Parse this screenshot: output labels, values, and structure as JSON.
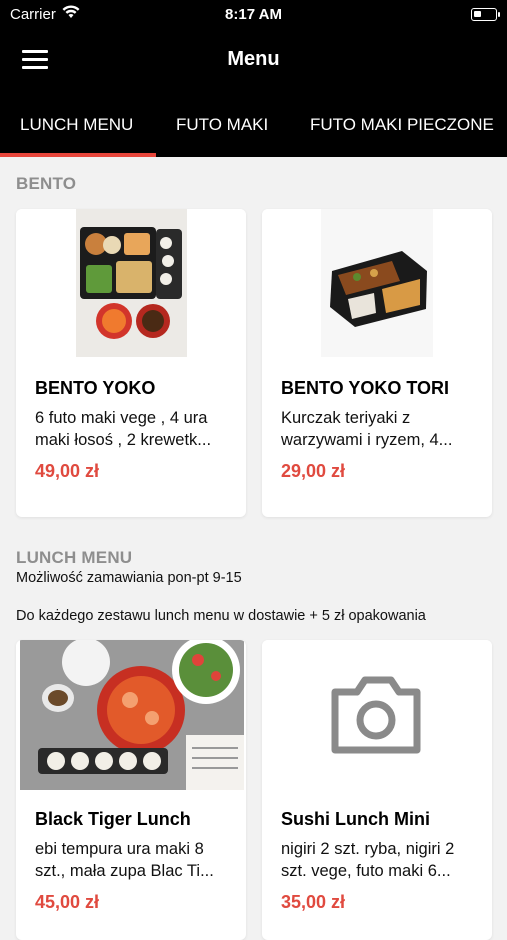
{
  "status": {
    "carrier": "Carrier",
    "time": "8:17 AM",
    "battery_level": 0.35
  },
  "nav": {
    "title": "Menu"
  },
  "tabs": [
    {
      "label": "LUNCH MENU",
      "active": true
    },
    {
      "label": "FUTO MAKI",
      "active": false
    },
    {
      "label": "FUTO MAKI PIECZONE",
      "active": false
    }
  ],
  "sections": [
    {
      "title": "BENTO",
      "items": [
        {
          "name": "BENTO YOKO",
          "desc_line1": "6 futo maki vege , 4 ura",
          "desc_line2": "maki łosoś , 2 krewetk...",
          "price": "49,00 zł"
        },
        {
          "name": "BENTO YOKO TORI",
          "desc_line1": "Kurczak teriyaki z",
          "desc_line2": "warzywami i ryzem, 4...",
          "price": "29,00 zł"
        }
      ]
    },
    {
      "title": "LUNCH MENU",
      "desc1": "Możliwość zamawiania pon-pt 9-15",
      "desc2": "Do każdego zestawu lunch menu w dostawie + 5 zł opakowania",
      "items": [
        {
          "name": "Black Tiger Lunch",
          "desc_line1": "ebi tempura ura maki 8",
          "desc_line2": "szt., mała zupa Blac Ti...",
          "price": "45,00 zł"
        },
        {
          "name": "Sushi Lunch Mini",
          "desc_line1": "nigiri 2 szt. ryba, nigiri 2",
          "desc_line2": "szt. vege, futo maki 6...",
          "price": "35,00 zł"
        }
      ]
    }
  ],
  "colors": {
    "accent": "#e8463b",
    "price": "#e04a3f",
    "section_title": "#8e8e8e"
  }
}
